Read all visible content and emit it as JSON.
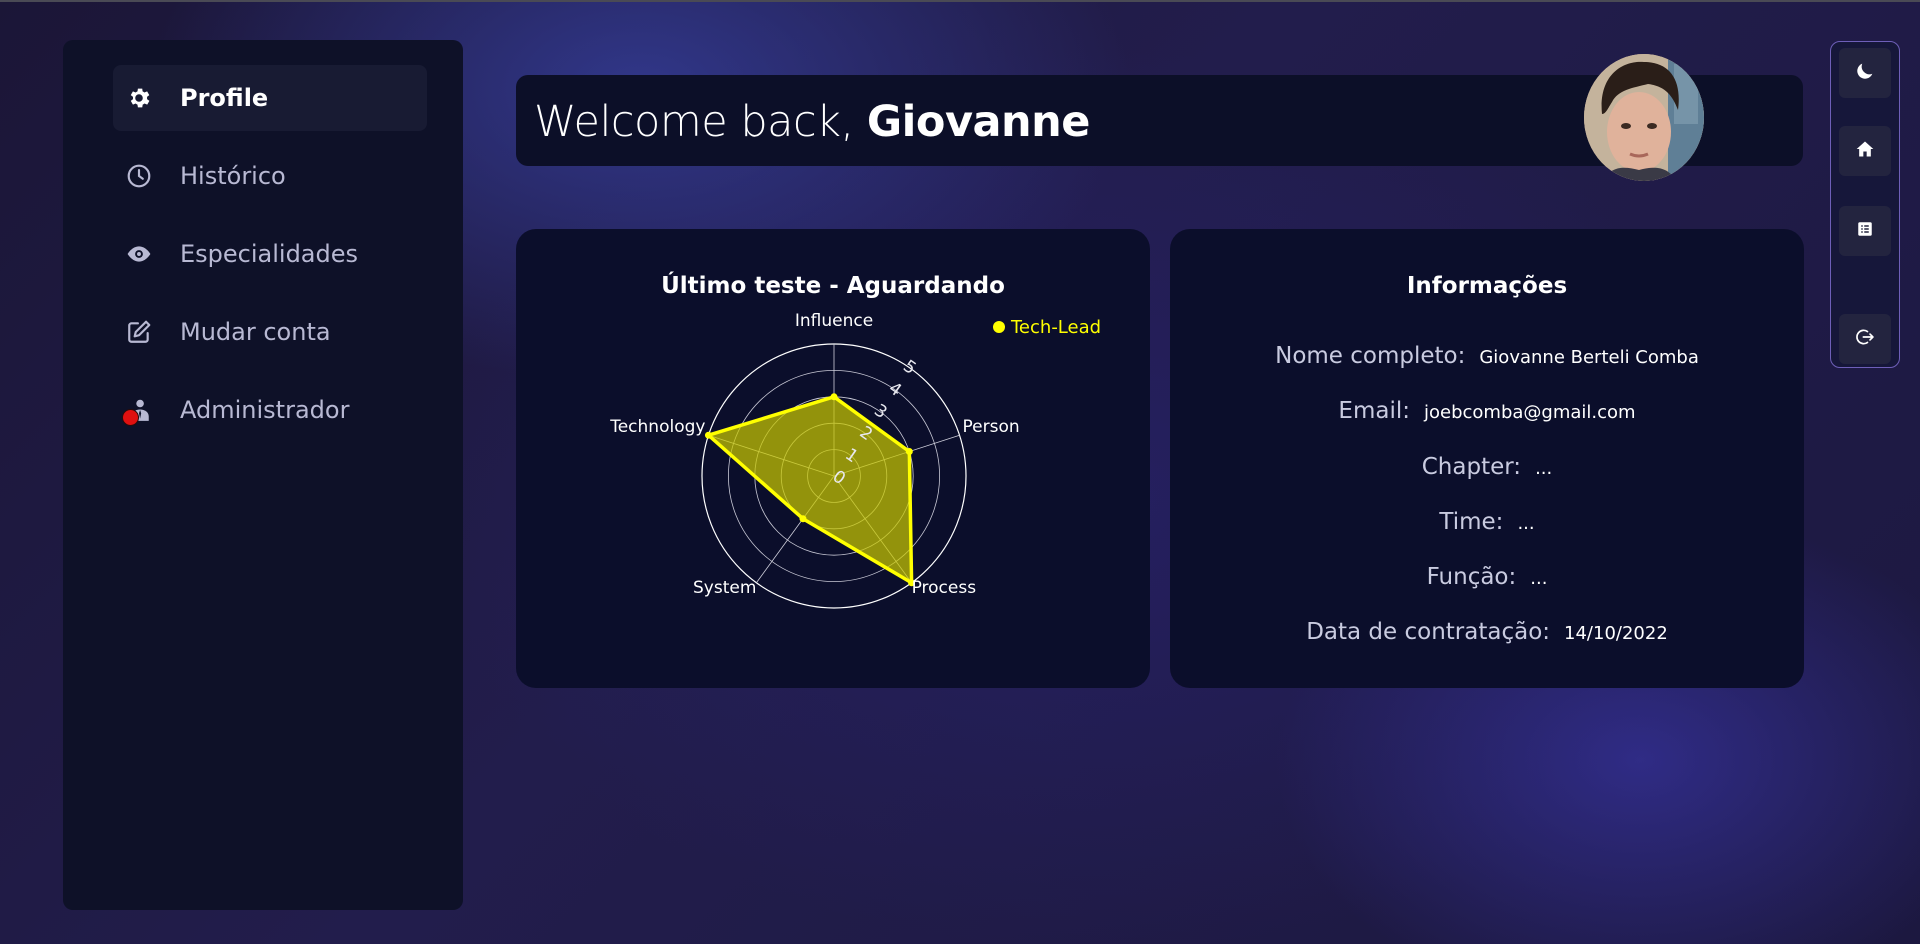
{
  "sidebar": {
    "items": [
      {
        "label": "Profile",
        "icon": "gear-icon",
        "active": true
      },
      {
        "label": "Histórico",
        "icon": "clock-icon"
      },
      {
        "label": "Especialidades",
        "icon": "eye-icon"
      },
      {
        "label": "Mudar conta",
        "icon": "edit-icon"
      },
      {
        "label": "Administrador",
        "icon": "admin-user-icon"
      }
    ]
  },
  "header": {
    "greeting": "Welcome back,",
    "user_name": "Giovanne"
  },
  "chart_card": {
    "title": "Último teste - Aguardando"
  },
  "chart_data": {
    "type": "radar",
    "axes": [
      "Influence",
      "Person",
      "Process",
      "System",
      "Technology"
    ],
    "rticks": [
      "0",
      "1",
      "2",
      "3",
      "4",
      "5"
    ],
    "rlim": [
      0,
      5
    ],
    "series": [
      {
        "name": "Tech-Lead",
        "values": [
          3,
          3,
          5,
          2,
          5
        ],
        "color": "#ffff00"
      }
    ],
    "legend_position": "top-right"
  },
  "info_card": {
    "title": "Informações",
    "fields": [
      {
        "label": "Nome completo:",
        "value": "Giovanne Berteli Comba"
      },
      {
        "label": "Email:",
        "value": "joebcomba@gmail.com"
      },
      {
        "label": "Chapter:",
        "value": "..."
      },
      {
        "label": "Time:",
        "value": "..."
      },
      {
        "label": "Função:",
        "value": "..."
      },
      {
        "label": "Data de contratação:",
        "value": "14/10/2022"
      }
    ]
  },
  "right_bar": {
    "buttons": [
      "moon-icon",
      "home-icon",
      "list-icon",
      "logout-icon"
    ]
  },
  "colors": {
    "accent": "#ffff00",
    "panel": "#0b0e2b",
    "notification": "#e01010"
  }
}
